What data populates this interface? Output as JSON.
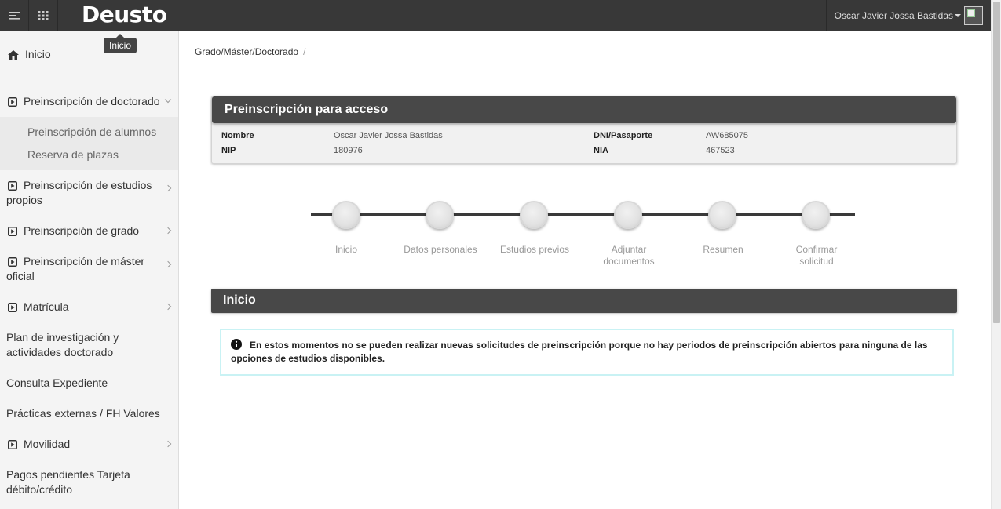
{
  "header": {
    "brand": "Deusto",
    "tooltip": "Inicio",
    "user_name": "Oscar Javier Jossa Bastidas"
  },
  "sidebar": {
    "items": [
      {
        "label": "Inicio"
      },
      {
        "label": "Preinscripción de doctorado"
      },
      {
        "label": "Preinscripción de alumnos"
      },
      {
        "label": "Reserva de plazas"
      },
      {
        "label": "Preinscripción de estudios propios"
      },
      {
        "label": "Preinscripción de grado"
      },
      {
        "label": "Preinscripción de máster oficial"
      },
      {
        "label": "Matrícula"
      },
      {
        "label": "Plan de investigación y actividades doctorado"
      },
      {
        "label": "Consulta Expediente"
      },
      {
        "label": "Prácticas externas / FH Valores"
      },
      {
        "label": "Movilidad"
      },
      {
        "label": "Pagos pendientes Tarjeta débito/crédito"
      }
    ]
  },
  "breadcrumb": {
    "item": "Grado/Máster/Doctorado",
    "separator": "/"
  },
  "access_panel": {
    "title": "Preinscripción para acceso",
    "nombre_label": "Nombre",
    "nombre_value": "Oscar Javier Jossa Bastidas",
    "nip_label": "NIP",
    "nip_value": "180976",
    "dni_label": "DNI/Pasaporte",
    "dni_value": "AW685075",
    "nia_label": "NIA",
    "nia_value": "467523"
  },
  "steps": [
    {
      "label": "Inicio"
    },
    {
      "label": "Datos personales"
    },
    {
      "label": "Estudios previos"
    },
    {
      "label": "Adjuntar documentos"
    },
    {
      "label": "Resumen"
    },
    {
      "label": "Confirmar solicitud"
    }
  ],
  "section": {
    "title": "Inicio"
  },
  "alert": {
    "message": "En estos momentos no se pueden realizar nuevas solicitudes de preinscripción porque no hay periodos de preinscripción abiertos para ninguna de las opciones de estudios disponibles."
  },
  "colors": {
    "topbar": "#383838",
    "panel_header": "#484848",
    "alert_border": "#c9f2f4",
    "sidebar_bg": "#f4f4f4"
  }
}
